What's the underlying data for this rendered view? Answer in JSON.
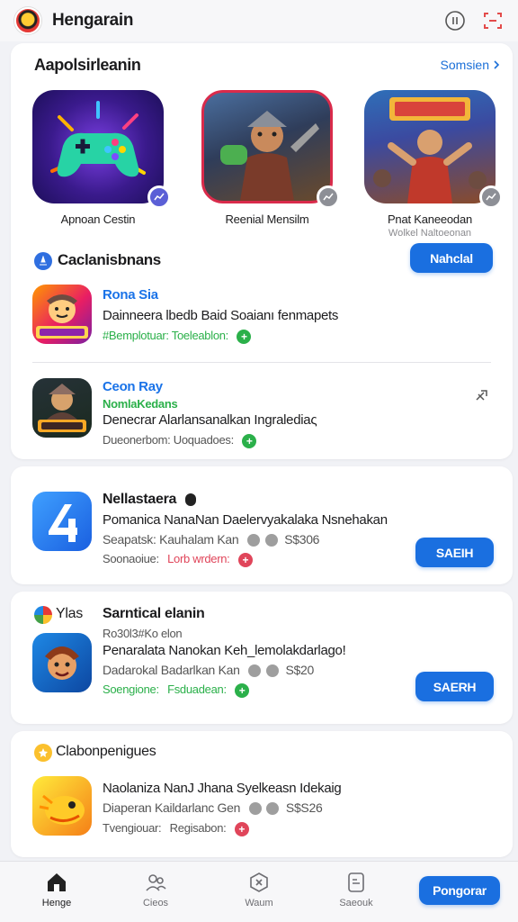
{
  "header": {
    "title": "Hengarain",
    "icons": [
      "app-logo",
      "info-icon",
      "scan-icon"
    ]
  },
  "featured": {
    "title": "Aapolsirleanin",
    "see_all": "Somsien",
    "items": [
      {
        "name": "Apnoan Cestin",
        "sub": ""
      },
      {
        "name": "Reenial Mensilm",
        "sub": ""
      },
      {
        "name": "Pnat Kaneeodan",
        "sub": "Wolkel Naltoeonan"
      }
    ]
  },
  "categories": {
    "title": "Caclanisbnans",
    "button": "Nahclal",
    "items": [
      {
        "name": "Rona Sia",
        "desc": "Dainneera lbedb Baid Soaianı fenmapets",
        "meta": "#Bemplotuar: Toeleablon:"
      },
      {
        "name": "Ceon Ray",
        "sub": "NomlaKedans",
        "desc": "Denecrar Alarlansanalkan Ingralediaς",
        "meta": "Dueonerbom: Uoquadoes:"
      }
    ]
  },
  "app_nll": {
    "title": "Nellastaera",
    "desc": "Pomanica NanaNan Daelervyakalaka Nsnehakan",
    "meta": "Seapatsk: Kauhalam Kan",
    "price": "S$306",
    "status_a": "Soonaoiue:",
    "status_b": "Lorb wrdern:",
    "button": "SAEIH"
  },
  "app_sar": {
    "section": "Ylas",
    "title": "Sarntical elanin",
    "sub": "Ro30l3#Ko elon",
    "desc": "Penaralata Nanokan Keh_lemolakdarlago!",
    "meta": "Dadarokal Badarlkan Kan",
    "price": "S$20",
    "status_a": "Soengione:",
    "status_b": "Fsduadean:",
    "button": "SAERH"
  },
  "app_cab": {
    "section": "Clabonpenigues",
    "desc": "Naolaniza NanJ Jhana Syelkeasn Idekaig",
    "meta": "Diaperan Kaildarlanc Gen",
    "price": "S$S26",
    "status_a": "Tvengiouar:",
    "status_b": "Regisabon:"
  },
  "bottom_nav": {
    "items": [
      {
        "label": "Henge"
      },
      {
        "label": "Cieos"
      },
      {
        "label": "Waum"
      },
      {
        "label": "Saeouk"
      }
    ],
    "cta": "Pongorar"
  },
  "colors": {
    "accent": "#1a6fe0",
    "link": "#1a73e8",
    "green": "#2bb04a",
    "red": "#e0455a"
  }
}
